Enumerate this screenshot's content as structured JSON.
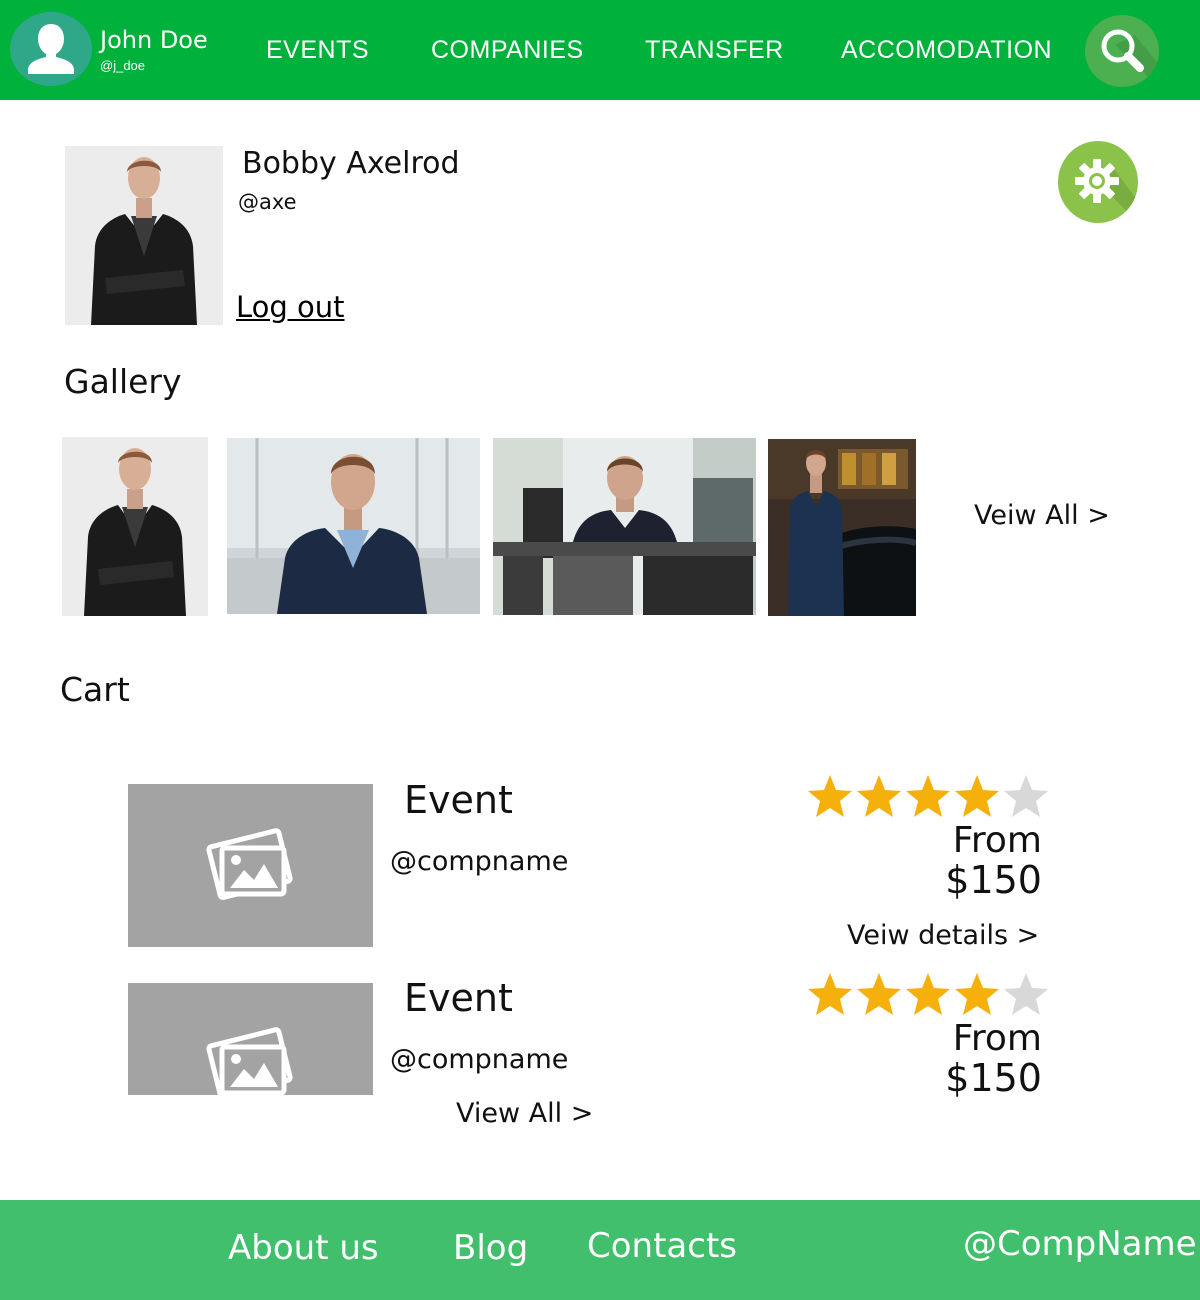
{
  "header": {
    "user_name": "John Doe",
    "user_handle": "@j_doe",
    "nav": [
      "EVENTS",
      "COMPANIES",
      "TRANSFER",
      "ACCOMODATION"
    ],
    "colors": {
      "bar": "#00b13b",
      "search_button": "#4caf50",
      "avatar_bg": "#2fa88a"
    },
    "icons": {
      "avatar": "user-silhouette-icon",
      "search": "magnifier-icon"
    }
  },
  "profile": {
    "name": "Bobby Axelrod",
    "handle": "@axe",
    "logout_label": "Log out",
    "settings_icon": "gear-icon"
  },
  "gallery": {
    "title": "Gallery",
    "view_all_label": "Veiw All >"
  },
  "cart": {
    "title": "Cart",
    "items": [
      {
        "title": "Event",
        "company": "@compname",
        "rating": 4,
        "rating_max": 5,
        "price_from": "From",
        "price": "$150",
        "details_label": "Veiw details >"
      },
      {
        "title": "Event",
        "company": "@compname",
        "rating": 4,
        "rating_max": 5,
        "price_from": "From",
        "price": "$150"
      }
    ],
    "view_all_label": "View All >",
    "placeholder_icon": "image-placeholder-icon",
    "colors": {
      "star_on": "#f6b00c",
      "star_off": "#d8d8d8",
      "placeholder": "#a3a3a3"
    }
  },
  "footer": {
    "links": [
      "About us",
      "Blog",
      "Contacts"
    ],
    "company": "@CompName",
    "color": "#41bf6c"
  }
}
